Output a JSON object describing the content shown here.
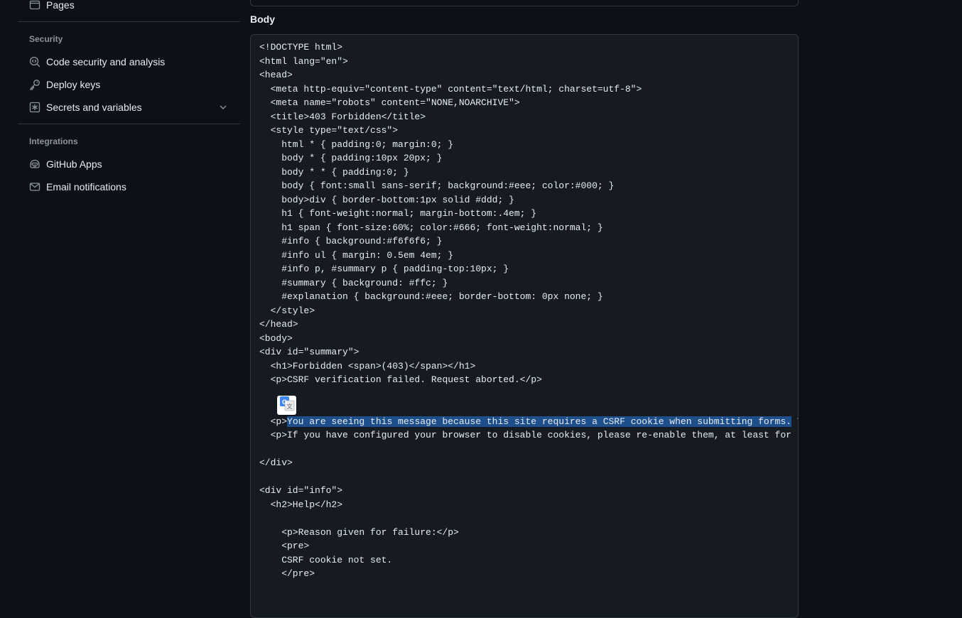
{
  "sidebar": {
    "top_item": {
      "label": "Pages",
      "icon": "browser-icon"
    },
    "security": {
      "heading": "Security",
      "items": [
        {
          "label": "Code security and analysis",
          "icon": "codescan-icon"
        },
        {
          "label": "Deploy keys",
          "icon": "key-icon"
        },
        {
          "label": "Secrets and variables",
          "icon": "asterisk-icon"
        }
      ]
    },
    "integrations": {
      "heading": "Integrations",
      "items": [
        {
          "label": "GitHub Apps",
          "icon": "hubot-icon"
        },
        {
          "label": "Email notifications",
          "icon": "mail-icon"
        }
      ]
    }
  },
  "main": {
    "body_label": "Body",
    "code_lines": [
      "<!DOCTYPE html>",
      "<html lang=\"en\">",
      "<head>",
      "  <meta http-equiv=\"content-type\" content=\"text/html; charset=utf-8\">",
      "  <meta name=\"robots\" content=\"NONE,NOARCHIVE\">",
      "  <title>403 Forbidden</title>",
      "  <style type=\"text/css\">",
      "    html * { padding:0; margin:0; }",
      "    body * { padding:10px 20px; }",
      "    body * * { padding:0; }",
      "    body { font:small sans-serif; background:#eee; color:#000; }",
      "    body>div { border-bottom:1px solid #ddd; }",
      "    h1 { font-weight:normal; margin-bottom:.4em; }",
      "    h1 span { font-size:60%; color:#666; font-weight:normal; }",
      "    #info { background:#f6f6f6; }",
      "    #info ul { margin: 0.5em 4em; }",
      "    #info p, #summary p { padding-top:10px; }",
      "    #summary { background: #ffc; }",
      "    #explanation { background:#eee; border-bottom: 0px none; }",
      "  </style>",
      "</head>",
      "<body>",
      "<div id=\"summary\">",
      "  <h1>Forbidden <span>(403)</span></h1>",
      "  <p>CSRF verification failed. Request aborted.</p>",
      ""
    ],
    "selected_line": {
      "prefix": "  <p>",
      "selected": "You are seeing this message because this site requires a CSRF cookie when submitting forms.",
      "suffix": " This cookie is required for security reasons, to ensure that your browser is not being hijacked by third parties.</p>"
    },
    "code_lines_after": [
      "  <p>If you have configured your browser to disable cookies, please re-enable them, at least for this site, or for “same-origin” requests.</p>",
      "",
      "</div>",
      "",
      "<div id=\"info\">",
      "  <h2>Help</h2>",
      "",
      "    <p>Reason given for failure:</p>",
      "    <pre>",
      "    CSRF cookie not set.",
      "    </pre>",
      "",
      ""
    ]
  },
  "colors": {
    "background": "#0d1117",
    "code_background": "#161b22",
    "border": "#30363d",
    "muted_text": "#8b949e",
    "selection": "#1f4f8b"
  }
}
